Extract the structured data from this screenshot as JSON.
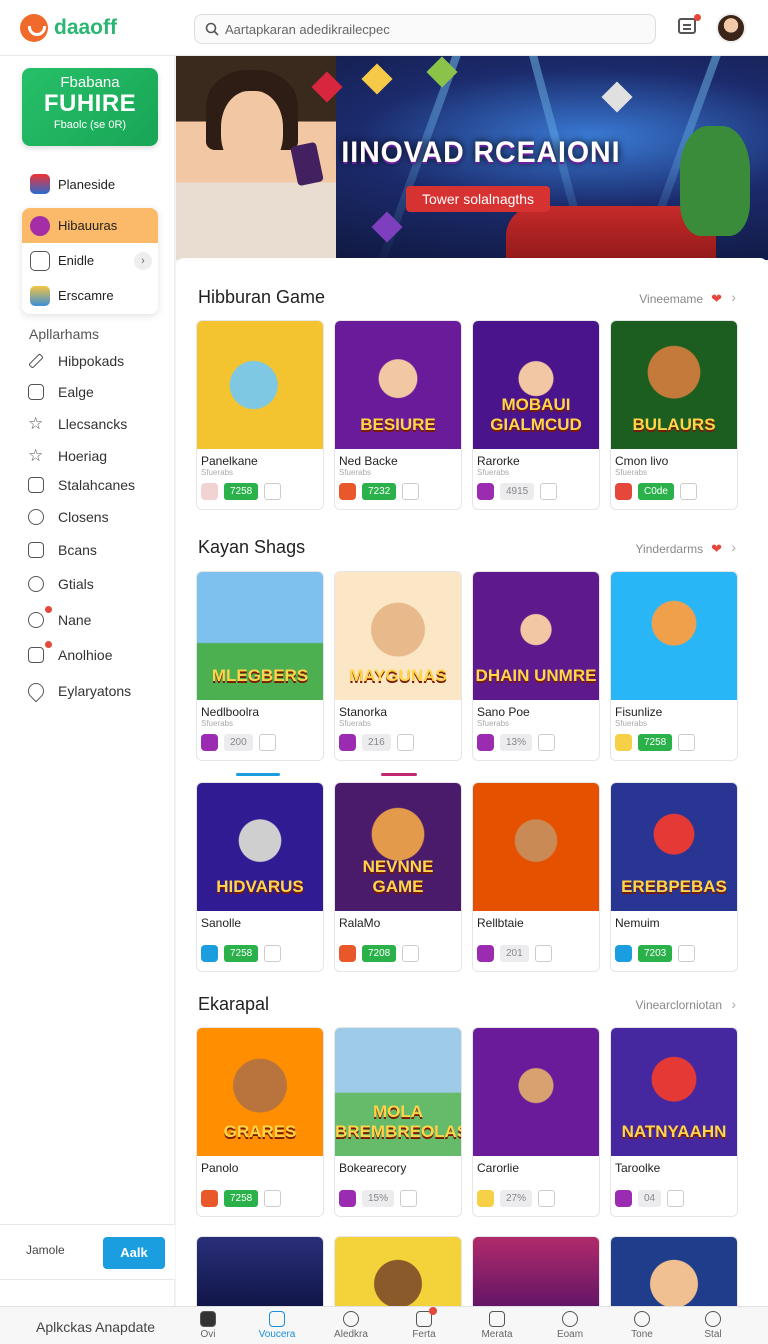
{
  "app": {
    "logo_text": "daaoff"
  },
  "search": {
    "placeholder": "Aartapkaran adedikrailecpec"
  },
  "sidebar": {
    "promo": {
      "line1": "Fbabana",
      "line2": "FUHIRE",
      "line3": "Fbaolc (se 0R)"
    },
    "feature_item": "Planeside",
    "group": [
      {
        "label": "Hibauuras",
        "active": true
      },
      {
        "label": "Enidle"
      },
      {
        "label": "Erscamre"
      }
    ],
    "section_label": "Apllarhams",
    "items": [
      {
        "label": "Hibpokads",
        "icon": "pencil-icon"
      },
      {
        "label": "Ealge",
        "icon": "box-icon"
      },
      {
        "label": "Llecsancks",
        "icon": "star-icon"
      },
      {
        "label": "Hoeriag",
        "icon": "star-outline-icon"
      },
      {
        "label": "Stalahcanes",
        "icon": "document-icon"
      },
      {
        "label": "Closens",
        "icon": "search-icon"
      },
      {
        "label": "Bcans",
        "icon": "grid-icon"
      },
      {
        "label": "Gtials",
        "icon": "magnifier-icon"
      },
      {
        "label": "Nane",
        "icon": "link-icon",
        "badge": true
      },
      {
        "label": "Anolhioe",
        "icon": "book-icon",
        "badge": true
      },
      {
        "label": "Eylaryatons",
        "icon": "location-icon"
      }
    ],
    "bottom": {
      "label": "Jamole",
      "button": "Aalk"
    }
  },
  "hero": {
    "title": "IINOVAD RCEAIONI",
    "tag": "Tower solalnagths"
  },
  "sections": [
    {
      "title": "Hibburan Game",
      "link": "Vineemame"
    },
    {
      "title": "Kayan Shags",
      "link": "Yinderdarms"
    },
    {
      "title": "Ekarapal",
      "link": "Vinearclorniotan"
    }
  ],
  "cards": [
    {
      "name": "Panelkane",
      "sub": "Sfuerabs",
      "art_text": "",
      "stat": "7258",
      "green": true
    },
    {
      "name": "Ned Backe",
      "sub": "Sfuerabs",
      "art_text": "BESIURE",
      "stat": "7232",
      "green": true
    },
    {
      "name": "Rarorke",
      "sub": "Sfuerabs",
      "art_text": "MOBAUI GIALMCUD",
      "stat": "4915",
      "green": false
    },
    {
      "name": "Cmon livo",
      "sub": "Sfuerabs",
      "art_text": "BULAURS",
      "stat": "C0de",
      "green": true
    },
    {
      "name": "Nedlboolra",
      "sub": "Sfuerabs",
      "art_text": "MLEGBERS",
      "stat": "200",
      "green": false
    },
    {
      "name": "Stanorka",
      "sub": "Sfuerabs",
      "art_text": "MAYGUNAS",
      "stat": "216",
      "green": false
    },
    {
      "name": "Sano Poe",
      "sub": "Sfuerabs",
      "art_text": "DHAIN UNMRE",
      "stat": "13%",
      "green": false
    },
    {
      "name": "Fisunlize",
      "sub": "Sfuerabs",
      "art_text": "",
      "stat": "7258",
      "green": true
    },
    {
      "name": "Sanolle",
      "sub": "",
      "art_text": "HIDVARUS",
      "stat": "7258",
      "green": true
    },
    {
      "name": "RalaMo",
      "sub": "",
      "art_text": "NEVNNE GAME",
      "stat": "7208",
      "green": true
    },
    {
      "name": "Rellbtaie",
      "sub": "",
      "art_text": "",
      "stat": "201",
      "green": false
    },
    {
      "name": "Nemuim",
      "sub": "",
      "art_text": "EREBPEBAS",
      "stat": "7203",
      "green": true
    },
    {
      "name": "Panolo",
      "sub": "",
      "art_text": "GRARES",
      "stat": "7258",
      "green": true
    },
    {
      "name": "Bokearecory",
      "sub": "",
      "art_text": "MOLA BREMBREOLAS",
      "stat": "15%",
      "green": false
    },
    {
      "name": "Carorlie",
      "sub": "",
      "art_text": "",
      "stat": "27%",
      "green": false
    },
    {
      "name": "Taroolke",
      "sub": "",
      "art_text": "NATNYAAHN",
      "stat": "04",
      "green": false
    }
  ],
  "bottom_nav": {
    "app_label": "Aplkckas Anapdate",
    "items": [
      {
        "label": "Ovi",
        "icon": "home-icon"
      },
      {
        "label": "Voucera",
        "icon": "tablet-icon",
        "active": true
      },
      {
        "label": "Aledkra",
        "icon": "clock-icon"
      },
      {
        "label": "Ferta",
        "icon": "tag-icon",
        "badge": true
      },
      {
        "label": "Merata",
        "icon": "book-icon"
      },
      {
        "label": "Eoam",
        "icon": "user-icon"
      },
      {
        "label": "Tone",
        "icon": "search-icon"
      },
      {
        "label": "Stal",
        "icon": "person-icon"
      }
    ]
  },
  "colors": {
    "accent": "#2bb673",
    "brand_orange": "#f06a2b",
    "primary_button": "#1a9ee0",
    "active_sidebar": "#fbb96a"
  }
}
